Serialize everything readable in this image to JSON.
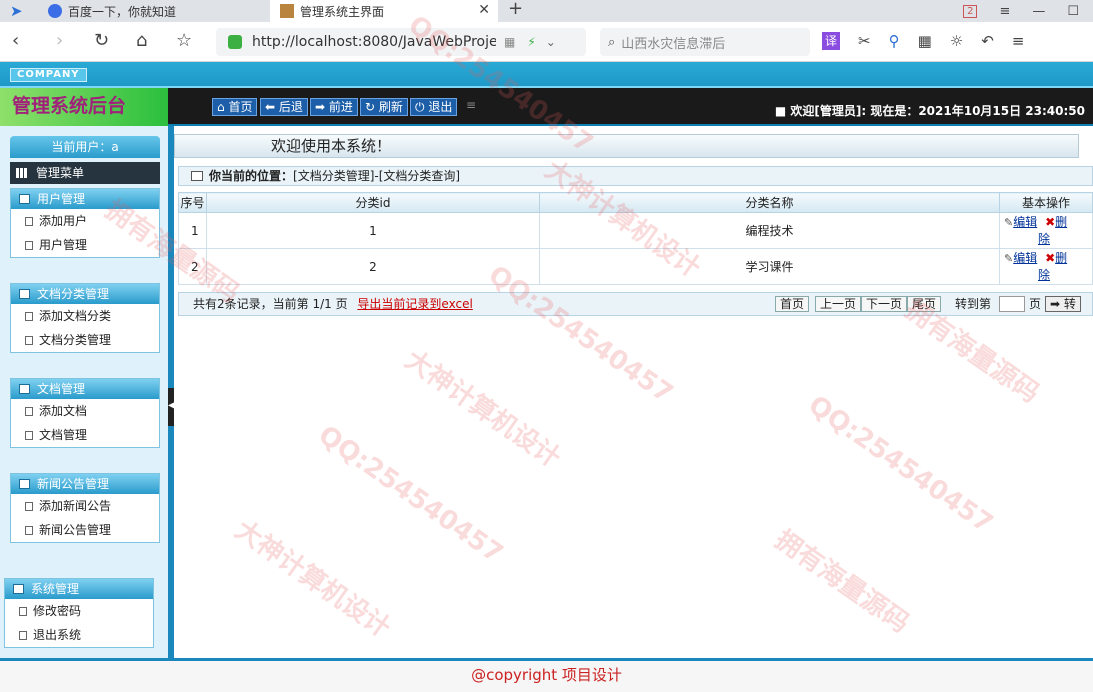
{
  "browser": {
    "tabs": [
      {
        "title": "百度一下，你就知道"
      },
      {
        "title": "管理系统主界面"
      }
    ],
    "url": "http://localhost:8080/JavaWebProje",
    "search_placeholder": "山西水灾信息滞后",
    "translate_label": "译",
    "tab_badge": "2"
  },
  "header": {
    "company": "COMPANY",
    "system_title": "管理系统后台",
    "nav": [
      {
        "label": "首页"
      },
      {
        "label": "后退"
      },
      {
        "label": "前进"
      },
      {
        "label": "刷新"
      },
      {
        "label": "退出"
      }
    ],
    "welcome": "■ 欢迎[管理员]:  现在是：2021年10月15日 23:40:50"
  },
  "sidebar": {
    "current_user": "当前用户：a",
    "menu_title": "管理菜单",
    "groups": [
      {
        "title": "用户管理",
        "items": [
          "添加用户",
          "用户管理"
        ]
      },
      {
        "title": "文档分类管理",
        "items": [
          "添加文档分类",
          "文档分类管理"
        ]
      },
      {
        "title": "文档管理",
        "items": [
          "添加文档",
          "文档管理"
        ]
      },
      {
        "title": "新闻公告管理",
        "items": [
          "添加新闻公告",
          "新闻公告管理"
        ]
      },
      {
        "title": "系统管理",
        "items": [
          "修改密码",
          "退出系统"
        ]
      }
    ]
  },
  "main": {
    "welcome": "欢迎使用本系统！",
    "position_label": "你当前的位置：",
    "position_path": "[文档分类管理]-[文档分类查询]",
    "table": {
      "headers": [
        "序号",
        "分类id",
        "分类名称",
        "基本操作"
      ],
      "rows": [
        {
          "index": "1",
          "id": "1",
          "name": "编程技术"
        },
        {
          "index": "2",
          "id": "2",
          "name": "学习课件"
        }
      ],
      "edit_label": "编辑",
      "delete_label_a": "删",
      "delete_label_b": "除"
    },
    "pager": {
      "summary": "共有2条记录，当前第 1/1 页",
      "export_label": "导出当前记录到excel",
      "first": "首页",
      "prev": "上一页",
      "next": "下一页",
      "last": "尾页",
      "goto_label": "转到第",
      "page_suffix": "页",
      "go": "➡ 转"
    }
  },
  "footer": {
    "copyright": "@copyright 项目设计"
  },
  "watermarks": [
    "QQ:254540457",
    "大神计算机设计",
    "拥有海量源码"
  ]
}
